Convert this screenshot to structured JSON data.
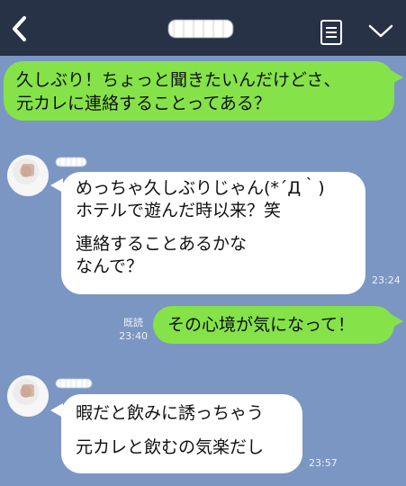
{
  "header": {
    "back_icon": "chevron-left-icon",
    "chat_name_pixelated": true,
    "memo_icon": "note-icon",
    "menu_icon": "chevron-down-icon"
  },
  "messages": [
    {
      "from": "me",
      "lines": [
        "久しぶり！ちょっと聞きたいんだけどさ、",
        "元カレに連絡することってある？"
      ]
    },
    {
      "from": "them",
      "lines": [
        "めっちゃ久しぶりじゃん(*´Д｀)",
        "ホテルで遊んだ時以来？笑",
        "",
        "連絡することあるかな",
        "なんで？"
      ],
      "time": "23:24"
    },
    {
      "from": "me",
      "lines": [
        "その心境が気になって！"
      ],
      "read": "既読",
      "time": "23:40"
    },
    {
      "from": "them",
      "lines": [
        "暇だと飲みに誘っちゃう",
        "",
        "元カレと飲むの気楽だし"
      ],
      "time": "23:57"
    }
  ],
  "colors": {
    "background": "#7b96c2",
    "header": "#273246",
    "my_bubble": "#85e249",
    "their_bubble": "#ffffff"
  }
}
